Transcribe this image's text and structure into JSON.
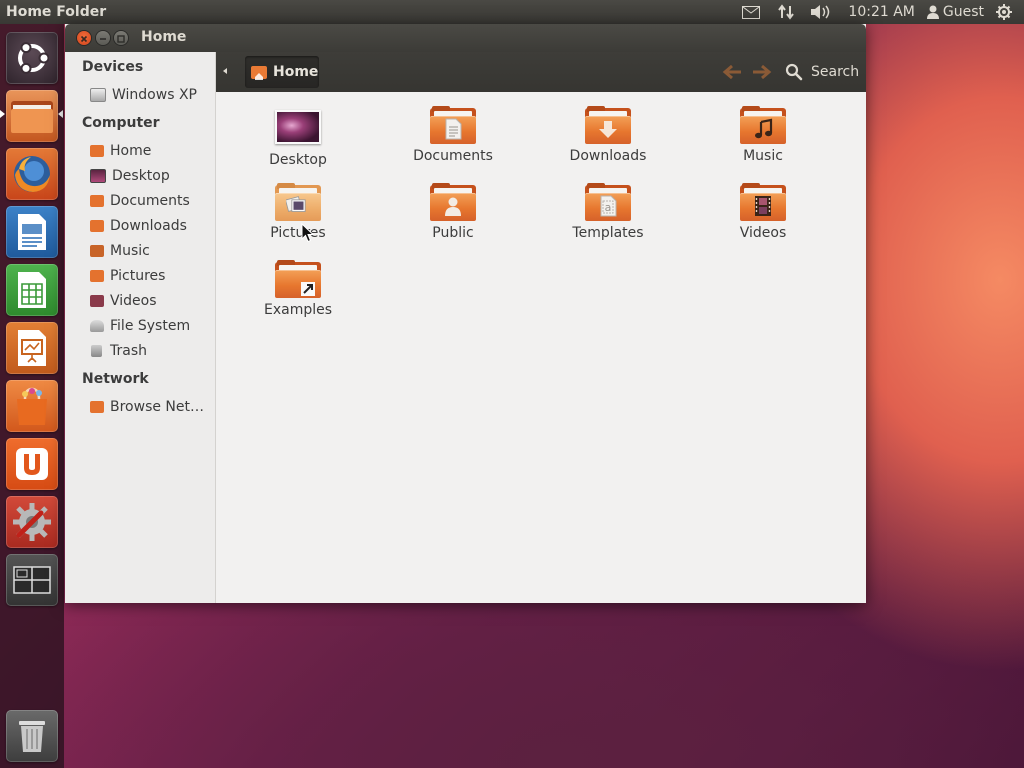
{
  "top_panel": {
    "window_title": "Home Folder",
    "clock": "10:21 AM",
    "user": "Guest",
    "icons": [
      "mail-icon",
      "network-icon",
      "volume-icon",
      "user-icon",
      "power-icon"
    ]
  },
  "launcher": {
    "items": [
      "ubuntu-dash",
      "files",
      "firefox",
      "libreoffice-writer",
      "libreoffice-calc",
      "libreoffice-impress",
      "ubuntu-software-center",
      "ubuntu-one",
      "system-settings",
      "workspace-switcher",
      "trash"
    ]
  },
  "window": {
    "title": "Home",
    "path_button": "Home",
    "search_label": "Search"
  },
  "sidebar": {
    "devices_heading": "Devices",
    "devices": [
      {
        "label": "Windows XP",
        "icon": "drive-icon"
      }
    ],
    "computer_heading": "Computer",
    "computer": [
      {
        "label": "Home",
        "icon": "home-folder-icon"
      },
      {
        "label": "Desktop",
        "icon": "desktop-icon"
      },
      {
        "label": "Documents",
        "icon": "documents-icon"
      },
      {
        "label": "Downloads",
        "icon": "downloads-icon"
      },
      {
        "label": "Music",
        "icon": "music-icon"
      },
      {
        "label": "Pictures",
        "icon": "pictures-icon"
      },
      {
        "label": "Videos",
        "icon": "videos-icon"
      },
      {
        "label": "File System",
        "icon": "filesystem-icon"
      },
      {
        "label": "Trash",
        "icon": "trash-icon"
      }
    ],
    "network_heading": "Network",
    "network": [
      {
        "label": "Browse Net…",
        "icon": "network-folder-icon"
      }
    ]
  },
  "files": [
    {
      "label": "Desktop"
    },
    {
      "label": "Documents"
    },
    {
      "label": "Downloads"
    },
    {
      "label": "Music"
    },
    {
      "label": "Pictures"
    },
    {
      "label": "Public"
    },
    {
      "label": "Templates"
    },
    {
      "label": "Videos"
    },
    {
      "label": "Examples"
    }
  ],
  "colors": {
    "accent": "#dd4814",
    "folder_orange": "#e7772f",
    "panel_bg": "#3c3b37"
  }
}
